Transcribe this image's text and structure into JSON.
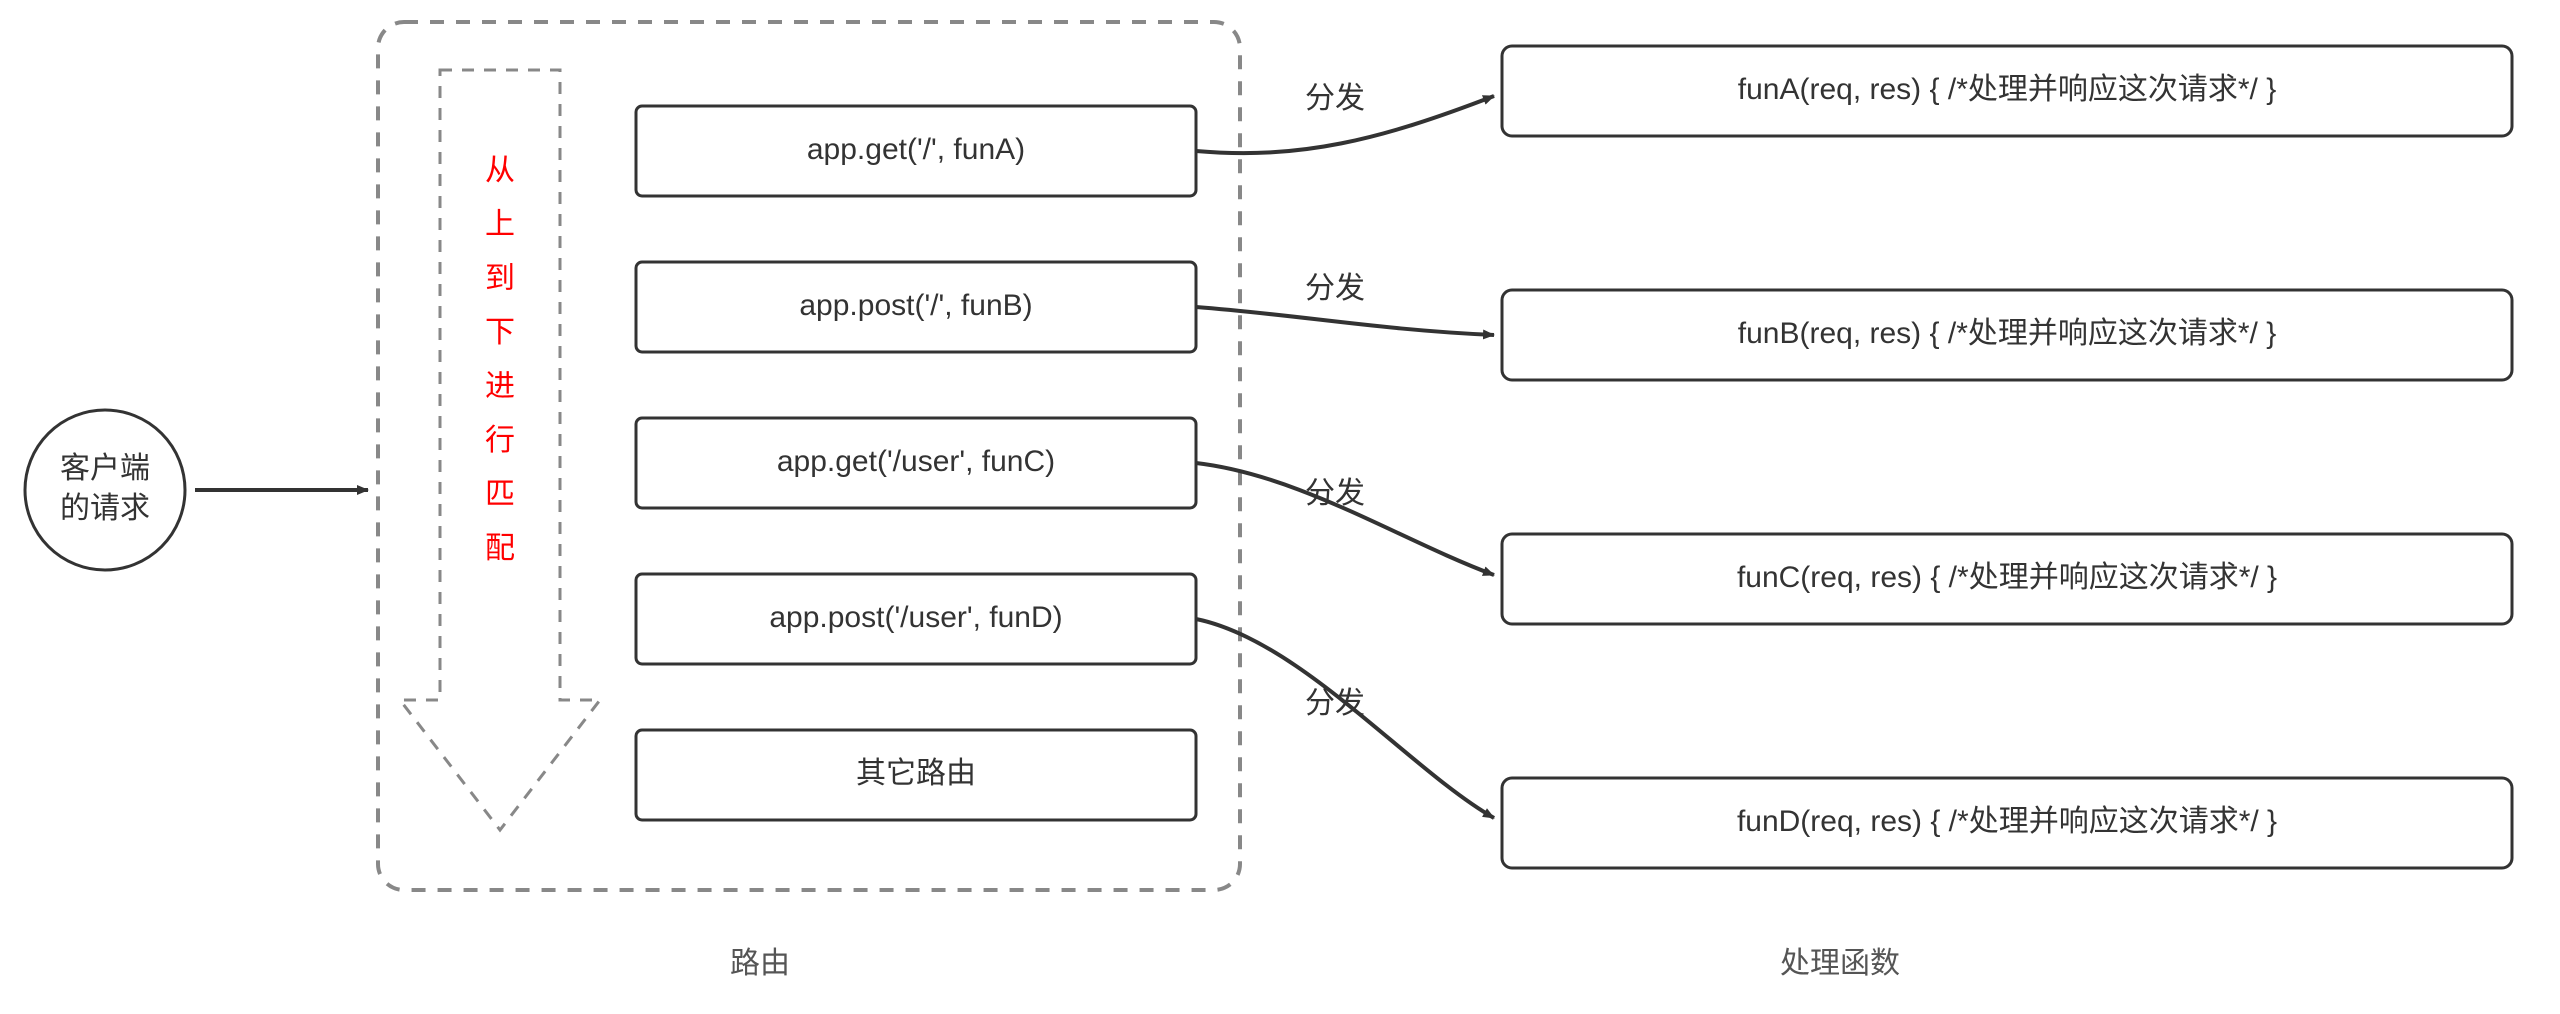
{
  "client": {
    "line1": "客户端",
    "line2": "的请求"
  },
  "matching_label": "从上到下进行匹配",
  "routes": [
    "app.get('/', funA)",
    "app.post('/', funB)",
    "app.get('/user', funC)",
    "app.post('/user', funD)",
    "其它路由"
  ],
  "dispatch_label": "分发",
  "handlers": [
    "funA(req, res) { /*处理并响应这次请求*/ }",
    "funB(req, res) { /*处理并响应这次请求*/ }",
    "funC(req, res) { /*处理并响应这次请求*/ }",
    "funD(req, res) { /*处理并响应这次请求*/ }"
  ],
  "caption_routes": "路由",
  "caption_handlers": "处理函数"
}
